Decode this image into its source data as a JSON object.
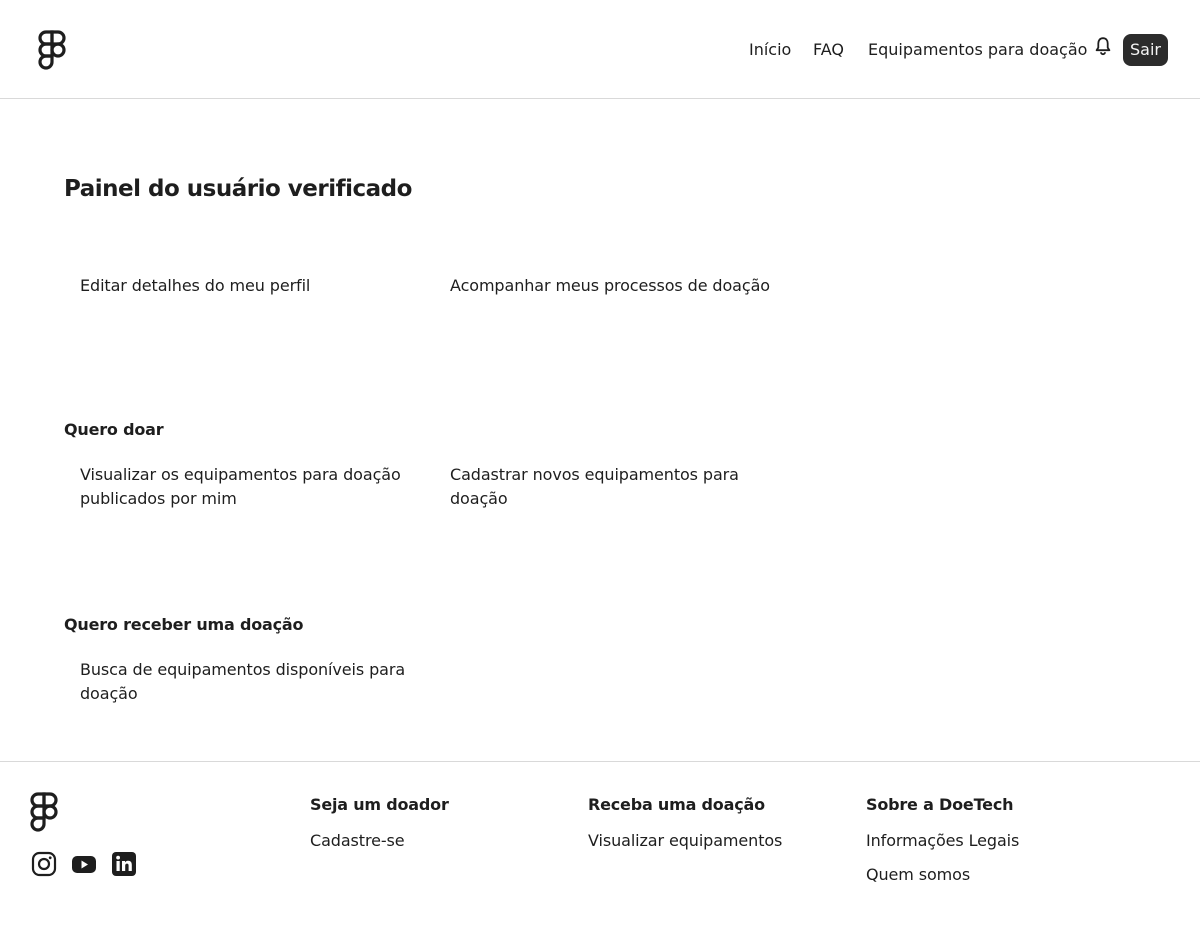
{
  "header": {
    "logo_icon": "figma-logo-icon",
    "nav": [
      {
        "label": "Início"
      },
      {
        "label": "FAQ"
      },
      {
        "label": "Equipamentos para doação"
      }
    ],
    "notification_icon": "bell-icon",
    "logout_label": "Sair"
  },
  "main": {
    "title": "Painel do usuário verificado",
    "profile_links": [
      {
        "label": "Editar detalhes do meu perfil"
      },
      {
        "label": "Acompanhar meus processos de doação"
      }
    ],
    "donate_section": {
      "title": "Quero doar",
      "links": [
        {
          "label": "Visualizar os equipamentos para doação publicados por mim"
        },
        {
          "label": "Cadastrar novos equipamentos para doação"
        }
      ]
    },
    "receive_section": {
      "title": "Quero receber uma doação",
      "links": [
        {
          "label": "Busca de equipamentos disponíveis para doação"
        }
      ]
    }
  },
  "footer": {
    "logo_icon": "figma-logo-icon",
    "social_icons": [
      "instagram-icon",
      "youtube-icon",
      "linkedin-icon"
    ],
    "columns": [
      {
        "title": "Seja um doador",
        "links": [
          {
            "label": "Cadastre-se"
          }
        ]
      },
      {
        "title": "Receba uma doação",
        "links": [
          {
            "label": "Visualizar equipamentos"
          }
        ]
      },
      {
        "title": "Sobre a DoeTech",
        "links": [
          {
            "label": "Informações Legais"
          },
          {
            "label": "Quem somos"
          }
        ]
      }
    ]
  },
  "colors": {
    "text": "#1e1e1e",
    "button_bg": "#2c2c2c",
    "button_text": "#f5f5f5",
    "divider": "#d9d9d9"
  }
}
